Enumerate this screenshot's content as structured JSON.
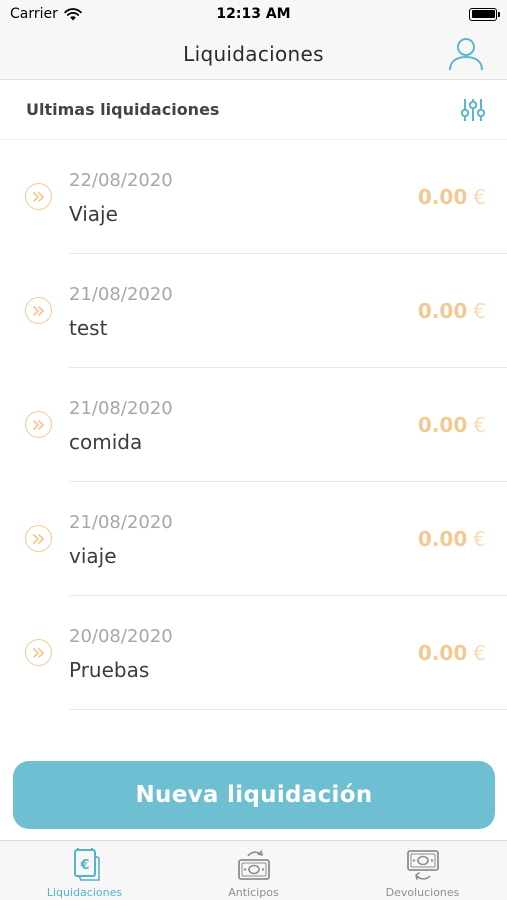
{
  "status_bar": {
    "carrier": "Carrier",
    "time": "12:13 AM"
  },
  "header": {
    "title": "Liquidaciones",
    "profile_icon": "user-icon"
  },
  "section": {
    "title": "Ultimas liquidaciones",
    "filter_icon": "sliders-icon"
  },
  "items": [
    {
      "date": "22/08/2020",
      "name": "Viaje",
      "amount": "0.00",
      "currency": "€"
    },
    {
      "date": "21/08/2020",
      "name": "test",
      "amount": "0.00",
      "currency": "€"
    },
    {
      "date": "21/08/2020",
      "name": "comida",
      "amount": "0.00",
      "currency": "€"
    },
    {
      "date": "21/08/2020",
      "name": "viaje",
      "amount": "0.00",
      "currency": "€"
    },
    {
      "date": "20/08/2020",
      "name": "Pruebas",
      "amount": "0.00",
      "currency": "€"
    }
  ],
  "cta": {
    "label": "Nueva liquidación"
  },
  "tabs": [
    {
      "label": "Liquidaciones",
      "icon": "euro-receipt-icon",
      "active": true
    },
    {
      "label": "Anticipos",
      "icon": "banknote-refresh-icon",
      "active": false
    },
    {
      "label": "Devoluciones",
      "icon": "banknote-return-icon",
      "active": false
    }
  ],
  "colors": {
    "accent": "#6dbfd1",
    "amount": "#f2c992",
    "tab_active": "#57b3c9"
  }
}
